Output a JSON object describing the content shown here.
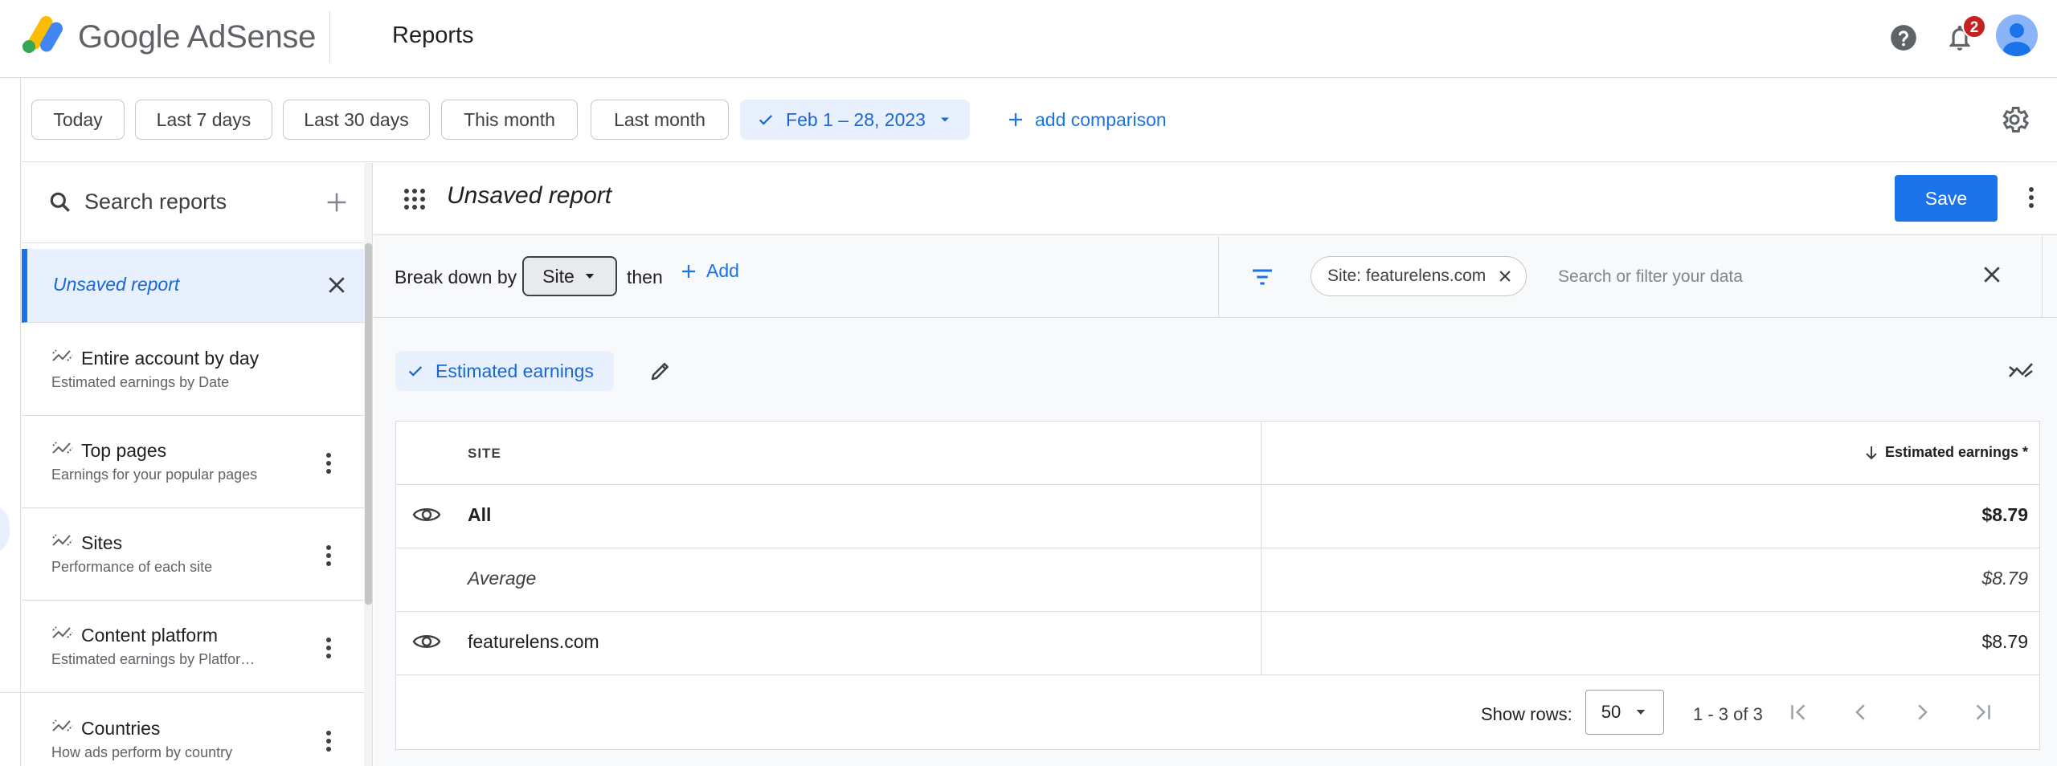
{
  "header": {
    "brand_google": "Google",
    "brand_product": "AdSense",
    "page_title": "Reports",
    "notification_count": "2",
    "colors": {
      "accent": "#1a73e8",
      "badge": "#c5221f",
      "logo_yellow": "#fbbc04",
      "logo_blue": "#4285f4",
      "logo_green": "#34a853"
    }
  },
  "datebar": {
    "chips": [
      {
        "label": "Today"
      },
      {
        "label": "Last 7 days"
      },
      {
        "label": "Last 30 days"
      },
      {
        "label": "This month"
      },
      {
        "label": "Last month"
      }
    ],
    "selected_range": "Feb 1 – 28, 2023",
    "add_comparison": "add comparison"
  },
  "sidebar": {
    "search_placeholder": "Search reports",
    "items": [
      {
        "title": "Unsaved report",
        "subtitle": "",
        "selected": true
      },
      {
        "title": "Entire account by day",
        "subtitle": "Estimated earnings by Date"
      },
      {
        "title": "Top pages",
        "subtitle": "Earnings for your popular pages"
      },
      {
        "title": "Sites",
        "subtitle": "Performance of each site"
      },
      {
        "title": "Content platform",
        "subtitle": "Estimated earnings by Platfor…"
      },
      {
        "title": "Countries",
        "subtitle": "How ads perform by country"
      }
    ]
  },
  "report": {
    "name": "Unsaved report",
    "save_label": "Save",
    "breakdown_label": "Break down by",
    "breakdown_value": "Site",
    "then_label": "then",
    "add_label": "Add",
    "filter_chip": "Site: featurelens.com",
    "filter_placeholder": "Search or filter your data",
    "metric_chip": "Estimated earnings"
  },
  "table": {
    "col_site": "SITE",
    "col_earnings": "Estimated earnings *",
    "rows": [
      {
        "label": "All",
        "value": "$8.79",
        "style": "bold"
      },
      {
        "label": "Average",
        "value": "$8.79",
        "style": "italic"
      },
      {
        "label": "featurelens.com",
        "value": "$8.79",
        "style": "normal"
      }
    ],
    "show_rows_label": "Show rows:",
    "rows_per_page": "50",
    "page_range": "1 - 3 of 3"
  }
}
